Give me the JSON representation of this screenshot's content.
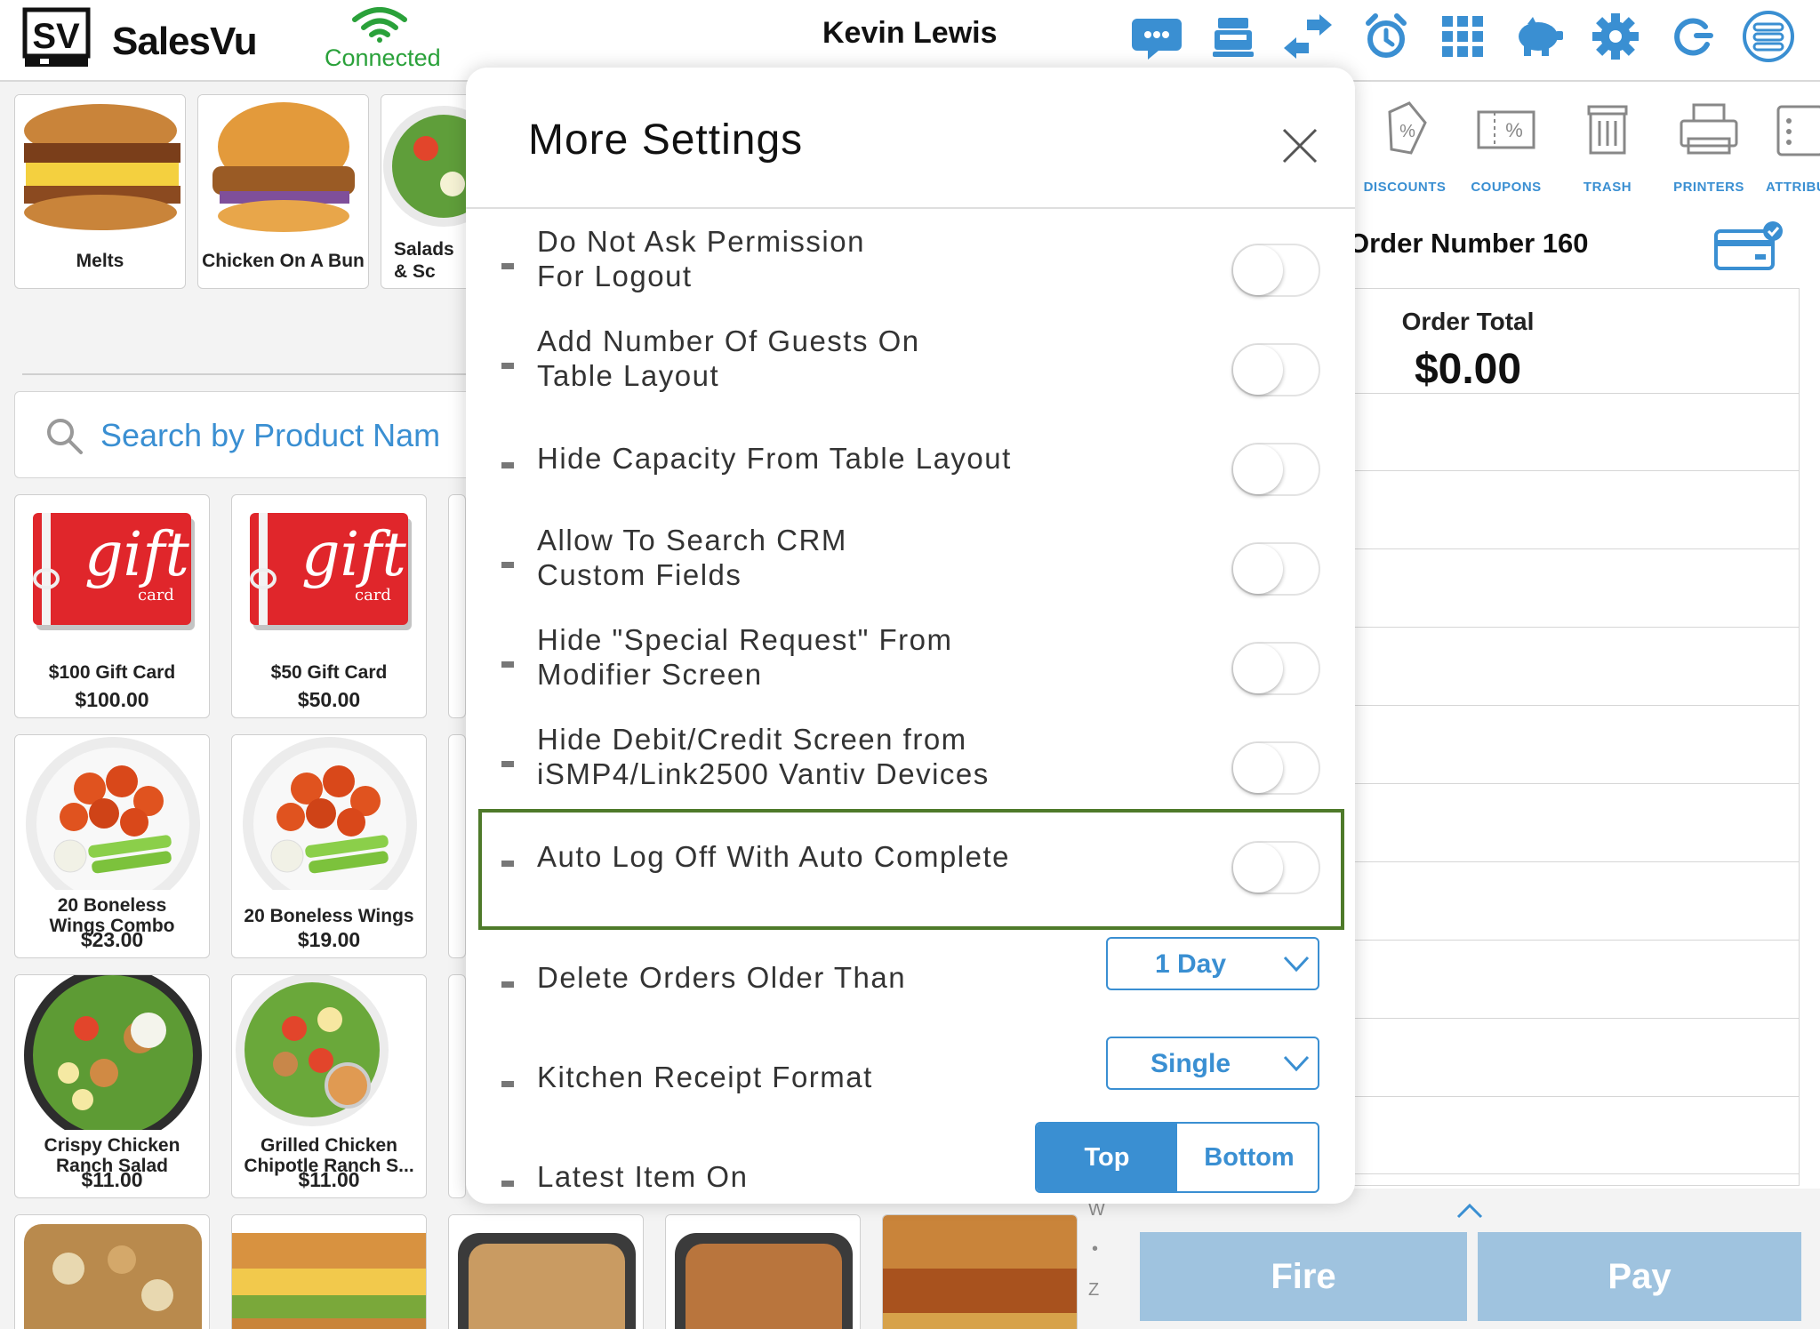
{
  "app": {
    "brand": "SalesVu",
    "logo_text": "SV",
    "connection_status": "Connected",
    "user_name": "Kevin Lewis"
  },
  "toolbar_icons": [
    "chat-icon",
    "register-icon",
    "transfer-icon",
    "alarm-clock-icon",
    "grid-icon",
    "piggy-bank-icon",
    "gear-icon",
    "refresh-icon",
    "menu-list-icon"
  ],
  "categories": [
    {
      "label": "Melts"
    },
    {
      "label": "Chicken On A Bun"
    },
    {
      "label": "Salads\n& Sc"
    }
  ],
  "search": {
    "placeholder": "Search by Product Nam"
  },
  "products": [
    {
      "name": "$100 Gift Card",
      "price": "$100.00"
    },
    {
      "name": "$50 Gift Card",
      "price": "$50.00"
    },
    {
      "name": "20 Boneless\nWings Combo",
      "price": "$23.00"
    },
    {
      "name": "20 Boneless Wings",
      "price": "$19.00"
    },
    {
      "name": "Crispy Chicken\nRanch Salad",
      "price": "$11.00"
    },
    {
      "name": "Grilled Chicken\nChipotle Ranch S...",
      "price": "$11.00"
    }
  ],
  "gift_card": {
    "big": "gift",
    "small": "card"
  },
  "right_toolbar": [
    {
      "label": "DISCOUNTS",
      "icon": "discount-tag-icon"
    },
    {
      "label": "COUPONS",
      "icon": "coupon-icon"
    },
    {
      "label": "TRASH",
      "icon": "trash-icon"
    },
    {
      "label": "PRINTERS",
      "icon": "printer-icon"
    },
    {
      "label": "ATTRIBU",
      "icon": "attributes-icon"
    }
  ],
  "order": {
    "number_label": "Order Number 160",
    "total_label": "Order Total",
    "total_amount": "$0.00"
  },
  "alphabet_index": [
    "W",
    "•",
    "Z"
  ],
  "actions": {
    "fire": "Fire",
    "pay": "Pay"
  },
  "modal": {
    "title": "More Settings",
    "toggles": [
      {
        "label": "Do Not Ask Permission\nFor Logout",
        "on": false
      },
      {
        "label": "Add Number Of Guests On\nTable Layout",
        "on": false
      },
      {
        "label": "Hide Capacity From Table Layout",
        "on": false
      },
      {
        "label": "Allow To Search CRM\nCustom Fields",
        "on": false
      },
      {
        "label": "Hide \"Special Request\" From\nModifier Screen",
        "on": false
      },
      {
        "label": "Hide Debit/Credit Screen from\niSMP4/Link2500 Vantiv Devices",
        "on": false
      },
      {
        "label": "Auto Log Off With Auto Complete",
        "on": false
      }
    ],
    "delete_orders": {
      "label": "Delete Orders Older Than",
      "value": "1 Day"
    },
    "kitchen_receipt": {
      "label": "Kitchen Receipt Format",
      "value": "Single"
    },
    "latest_item": {
      "label": "Latest Item On",
      "options": [
        "Top",
        "Bottom"
      ],
      "selected": "Top"
    }
  },
  "colors": {
    "accent": "#3a8fd2",
    "connected": "#2aa13a",
    "highlight": "#4e7a2a",
    "action_disabled": "#9fc3df"
  }
}
